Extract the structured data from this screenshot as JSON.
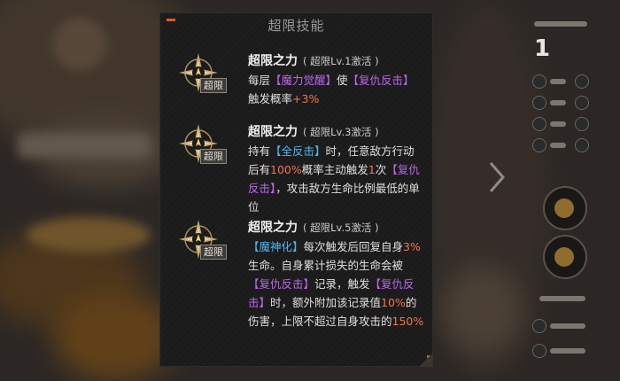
{
  "panel": {
    "title": "超限技能"
  },
  "skills": [
    {
      "name": "超限之力",
      "condition": "( 超限Lv.1激活 )",
      "badge": "超限",
      "desc": {
        "t1": "每层",
        "k1": "【魔力觉醒】",
        "t2": "使",
        "k2": "【复仇反击】",
        "t3": "触发概率",
        "v1": "+3%"
      }
    },
    {
      "name": "超限之力",
      "condition": "( 超限Lv.3激活 )",
      "badge": "超限",
      "desc": {
        "t1": "持有",
        "k1": "【全反击】",
        "t2": "时，任意敌方行动后有",
        "v1": "100%",
        "t3": "概率主动触发",
        "v2": "1",
        "t4": "次",
        "k2": "【复仇反击】",
        "t5": "，攻击敌方生命比例最低的单位"
      }
    },
    {
      "name": "超限之力",
      "condition": "( 超限Lv.5激活 )",
      "badge": "超限",
      "desc": {
        "k1": "【魔神化】",
        "t1": "每次触发后回复自身",
        "v1": "3%",
        "t2": "生命。自身累计损失的生命会被",
        "k2": "【复仇反击】",
        "t3": "记录，触发",
        "k3": "【复仇反击】",
        "t4": "时，额外附加该记录值",
        "v2": "10%",
        "t5": "的伤害，上限不超过自身攻击的",
        "v3": "150%"
      }
    }
  ],
  "sidebar": {
    "count": "1"
  },
  "colors": {
    "keyword_blue": "#4fb6ef",
    "keyword_purple": "#b969e8",
    "value_orange": "#f0764a",
    "accent": "#e35a1e"
  },
  "icons": [
    "compass-star-emblem-icon",
    "next-arrow-icon",
    "avatar-icon"
  ]
}
